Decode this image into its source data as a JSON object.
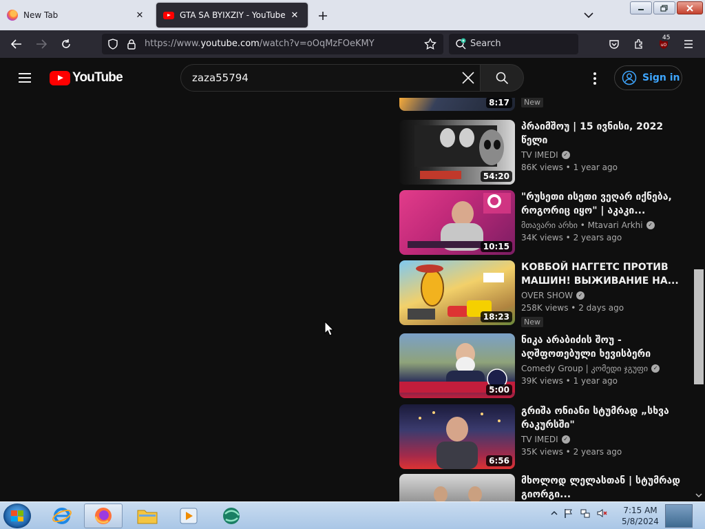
{
  "browser": {
    "tabs": [
      {
        "title": "New Tab",
        "active": false
      },
      {
        "title": "GTA SA BYIXZIY - YouTube",
        "active": true
      }
    ],
    "url_prefix": "https://www.",
    "url_domain": "youtube.com",
    "url_path": "/watch?v=oOqMzFOeKMY",
    "search_placeholder": "Search",
    "extension_badge": "45"
  },
  "youtube": {
    "logo_text": "YouTube",
    "search_query": "zaza55794",
    "sign_in_label": "Sign in",
    "videos": [
      {
        "title": "",
        "channel": "",
        "verified": false,
        "views": "",
        "age": "",
        "duration": "8:17",
        "new_label": "New"
      },
      {
        "title": "პრაიმშოუ | 15 ივნისი, 2022 წელი",
        "channel": "TV IMEDI",
        "verified": true,
        "views": "86K views",
        "age": "1 year ago",
        "duration": "54:20",
        "new_label": ""
      },
      {
        "title": "\"რუსეთი ისეთი ვეღარ იქნება, როგორიც იყო\" | აკაკი...",
        "channel": "მთავარი არხი • Mtavari Arkhi",
        "verified": true,
        "views": "34K views",
        "age": "2 years ago",
        "duration": "10:15",
        "new_label": ""
      },
      {
        "title": "КОВБОЙ НАГГЕТС ПРОТИВ МАШИН! ВЫЖИВАНИЕ НА...",
        "channel": "OVER SHOW",
        "verified": true,
        "views": "258K views",
        "age": "2 days ago",
        "duration": "18:23",
        "new_label": "New"
      },
      {
        "title": "ნიკა არაბიძის შოუ - აღშფოთებული ხევისბერი",
        "channel": "Comedy Group | კომედი ჯგუფი",
        "verified": true,
        "views": "39K views",
        "age": "1 year ago",
        "duration": "5:00",
        "new_label": ""
      },
      {
        "title": "გრიშა ონიანი სტუმრად „სხვა რაკურსში\"",
        "channel": "TV IMEDI",
        "verified": true,
        "views": "35K views",
        "age": "2 years ago",
        "duration": "6:56",
        "new_label": ""
      },
      {
        "title": "მხოლოდ ლელასთან | სტუმრად გიორგი...",
        "channel": "",
        "verified": false,
        "views": "",
        "age": "",
        "duration": "",
        "new_label": ""
      }
    ]
  },
  "taskbar": {
    "time": "7:15 AM",
    "date": "5/8/2024"
  },
  "colors": {
    "yt_red": "#ff0000",
    "link_blue": "#3ea6ff",
    "page_bg": "#0f0f0f",
    "toolbar_bg": "#2b2a33"
  }
}
